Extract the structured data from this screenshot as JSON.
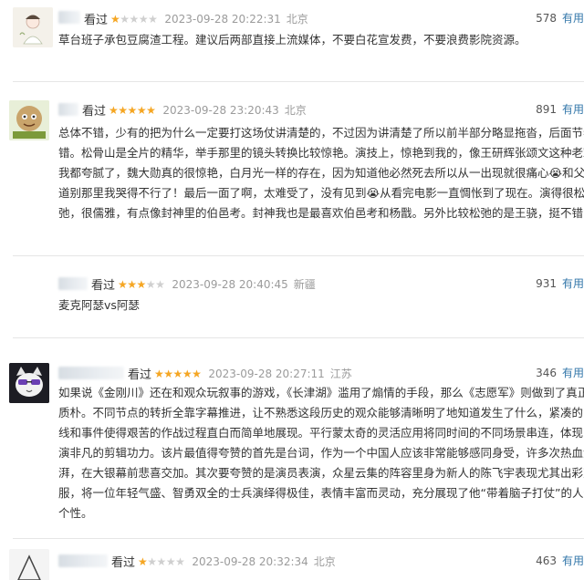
{
  "useful_label": "有用",
  "reviews": [
    {
      "status": "看过",
      "stars": 1,
      "time": "2023-09-28 20:22:31",
      "location": "北京",
      "votes": "578",
      "text": "草台班子承包豆腐渣工程。建议后两部直接上流媒体，不要白花宣发费，不要浪费影院资源。"
    },
    {
      "status": "看过",
      "stars": 5,
      "time": "2023-09-28 23:20:43",
      "location": "北京",
      "votes": "891",
      "text": "总体不错，少有的把为什么一定要打这场仗讲清楚的，不过因为讲清楚了所以前半部分略显拖沓，后面节奏不错。松骨山是全片的精华，举手那里的镜头转换比较惊艳。演技上，惊艳到我的，像王研辉张颂文这种老戏骨我都夸腻了，魏大勋真的很惊艳，白月光一样的存在，因为知道他必然死去所以从一出现就很痛心😭和父亲道别那里我哭得不行了！最后一面了啊，太难受了，没有见到😭从看完电影一直惆怅到了现在。演得很松弛，很儒雅，有点像封神里的伯邑考。封神我也是最喜欢伯邑考和杨戬。另外比较松弛的是王骁，挺不错的。"
    },
    {
      "status": "看过",
      "stars": 3,
      "time": "2023-09-28 20:40:45",
      "location": "新疆",
      "votes": "931",
      "text": "麦克阿瑟vs阿瑟"
    },
    {
      "status": "看过",
      "stars": 5,
      "time": "2023-09-28 20:27:11",
      "location": "江苏",
      "votes": "346",
      "text": "如果说《金刚川》还在和观众玩叙事的游戏，《长津湖》滥用了煽情的手段，那么《志愿军》则做到了真正的质朴。不同节点的转折全靠字幕推进，让不熟悉这段历史的观众能够清晰明了地知道发生了什么，紧凑的时间线和事件使得艰苦的作战过程直白而简单地展现。平行蒙太奇的灵活应用将同时间的不同场景串连，体现了导演非凡的剪辑功力。该片最值得夸赞的首先是台词，作为一个中国人应该非常能够感同身受，许多次热血澎湃，在大银幕前悲喜交加。其次要夸赞的是演员表演，众星云集的阵容里身为新人的陈飞宇表现尤其出彩克服，将一位年轻气盛、智勇双全的士兵演绎得极佳，表情丰富而灵动，充分展现了他“带着脑子打仗”的人物个性。"
    },
    {
      "status": "看过",
      "stars": 1,
      "time": "2023-09-28 20:32:34",
      "location": "北京",
      "votes": "463",
      "text": ""
    }
  ]
}
